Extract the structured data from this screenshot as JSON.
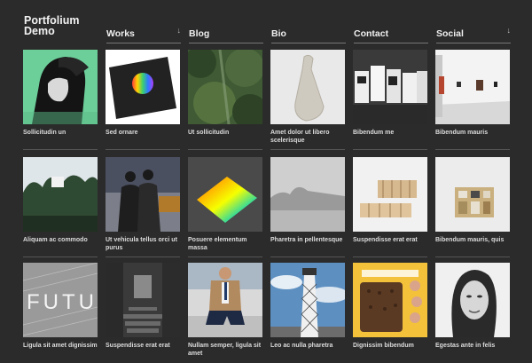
{
  "brand": {
    "line1": "Portfolium",
    "line2": "Demo"
  },
  "nav": [
    {
      "label": "Works",
      "arrow": "↓"
    },
    {
      "label": "Blog",
      "arrow": ""
    },
    {
      "label": "Bio",
      "arrow": ""
    },
    {
      "label": "Contact",
      "arrow": ""
    },
    {
      "label": "Social",
      "arrow": "↓"
    }
  ],
  "captions": [
    "Sollicitudin un",
    "Sed ornare",
    "Ut sollicitudin",
    "Amet dolor ut libero scelerisque",
    "Bibendum me",
    "Bibendum mauris",
    "Aliquam ac commodo",
    "Ut vehicula tellus orci ut purus",
    "Posuere elementum massa",
    "Pharetra in pellentesque",
    "Suspendisse erat erat",
    "Bibendum mauris, quis",
    "Ligula sit amet dignissim",
    "Suspendisse erat erat",
    "Nullam semper, ligula sit amet",
    "Leo ac nulla pharetra",
    "Dignissim bibendum",
    "Egestas ante in felis"
  ],
  "art_text": {
    "futu": "FUTU"
  }
}
